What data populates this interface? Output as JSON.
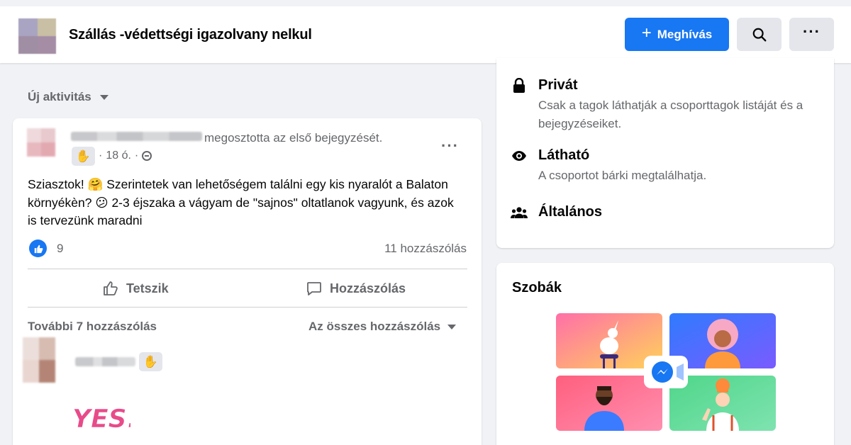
{
  "header": {
    "group_title": "Szállás -védettségi igazolvany nelkul",
    "invite_label": "Meghívás",
    "invite_plus": "+"
  },
  "feed": {
    "sort_label": "Új aktivitás"
  },
  "post": {
    "shared_text": "megosztotta az első bejegyzését.",
    "time": "18 ó.",
    "text": "Sziasztok! 🤗 Szerintetek van lehetőségem találni egy kis nyaralót a Balaton környékèn? 😕 2-3 éjszaka a vágyam de \"sajnos\" oltatlanok vagyunk, és azok is tervezünk maradni",
    "like_count": "9",
    "comment_count": "11 hozzászólás",
    "like_action": "Tetszik",
    "comment_action": "Hozzászólás",
    "more_comments": "További 7 hozzászólás",
    "all_comments": "Az összes hozzászólás",
    "gif_text": "YES!"
  },
  "about": {
    "items": [
      {
        "title": "Privát",
        "desc": "Csak a tagok láthatják a csoporttagok listáját és a bejegyzéseiket.",
        "icon": "lock-icon"
      },
      {
        "title": "Látható",
        "desc": "A csoportot bárki megtalálhatja.",
        "icon": "eye-icon"
      },
      {
        "title": "Általános",
        "desc": "",
        "icon": "people-icon"
      }
    ]
  },
  "rooms": {
    "title": "Szobák"
  },
  "colors": {
    "accent": "#1877f2",
    "background": "#f0f2f5",
    "secondary_text": "#65676b"
  }
}
